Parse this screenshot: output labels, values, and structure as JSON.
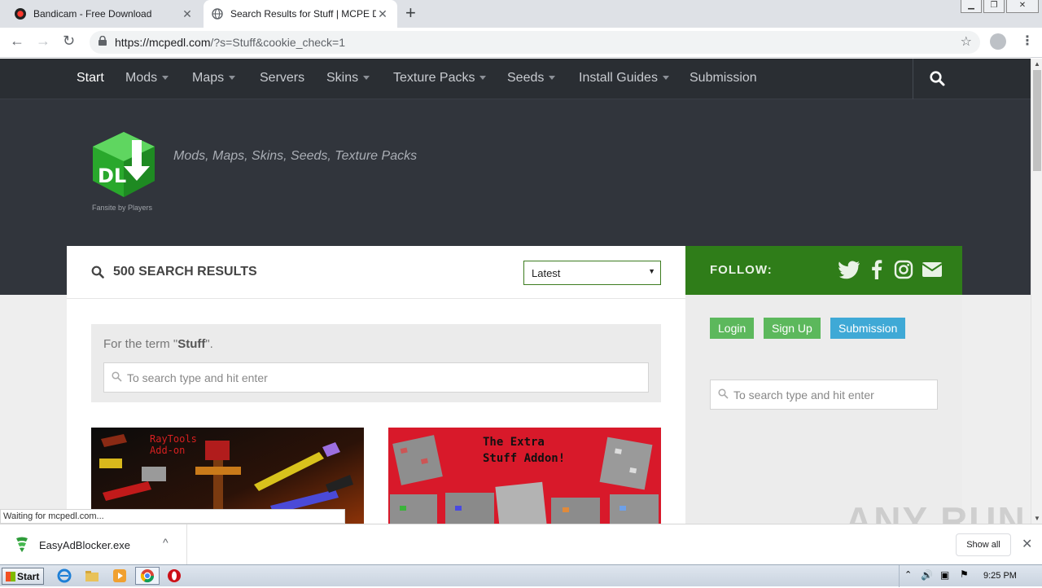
{
  "browser": {
    "tabs": [
      {
        "title": "Bandicam - Free Download",
        "close": "✕"
      },
      {
        "title": "Search Results for Stuff | MCPE DL",
        "close": "✕"
      }
    ],
    "new_tab": "+",
    "url_domain": "https://mcpedl.com",
    "url_rest": "/?s=Stuff&cookie_check=1",
    "back": "←",
    "forward": "→",
    "reload": "↻",
    "bookmark": "☆",
    "menu": "⋮",
    "window_controls": [
      "▁",
      "❐",
      "✕"
    ]
  },
  "site_nav": {
    "items": [
      {
        "label": "Start",
        "dropdown": false
      },
      {
        "label": "Mods",
        "dropdown": true
      },
      {
        "label": "Maps",
        "dropdown": true
      },
      {
        "label": "Servers",
        "dropdown": false
      },
      {
        "label": "Skins",
        "dropdown": true
      },
      {
        "label": "Texture Packs",
        "dropdown": true
      },
      {
        "label": "Seeds",
        "dropdown": true
      },
      {
        "label": "Install Guides",
        "dropdown": true
      },
      {
        "label": "Submission",
        "dropdown": false
      }
    ]
  },
  "hero": {
    "logo_text": "DL",
    "tagline": "Mods, Maps, Skins, Seeds, Texture Packs",
    "fansite": "Fansite by Players"
  },
  "results": {
    "count_label": "500 SEARCH RESULTS",
    "sort_selected": "Latest",
    "term_prefix": "For the term \"",
    "term": "Stuff",
    "term_suffix": "\".",
    "search_placeholder": "To search type and hit enter",
    "cards": [
      {
        "title_line1": "RayTools",
        "title_line2": "Add-on"
      },
      {
        "title_line1": "The Extra",
        "title_line2": "Stuff Addon!"
      }
    ]
  },
  "sidebar": {
    "follow_label": "FOLLOW:",
    "social_icons": [
      "twitter-icon",
      "facebook-icon",
      "instagram-icon",
      "email-icon"
    ],
    "buttons": [
      {
        "label": "Login",
        "color": "#5cb85c"
      },
      {
        "label": "Sign Up",
        "color": "#5cb85c"
      },
      {
        "label": "Submission",
        "color": "#3fa9d6"
      }
    ],
    "search_placeholder": "To search type and hit enter"
  },
  "status_text": "Waiting for mcpedl.com...",
  "watermark": "ANY RUN",
  "download_bar": {
    "file": "EasyAdBlocker.exe",
    "chevron": "^",
    "show_all": "Show all",
    "close": "✕"
  },
  "taskbar": {
    "start": "Start",
    "time": "9:25 PM"
  },
  "colors": {
    "nav_bg": "#2a2e33",
    "hero_bg": "#31353c",
    "follow_green": "#2f7d19",
    "logo_green": "#2ebd32"
  }
}
